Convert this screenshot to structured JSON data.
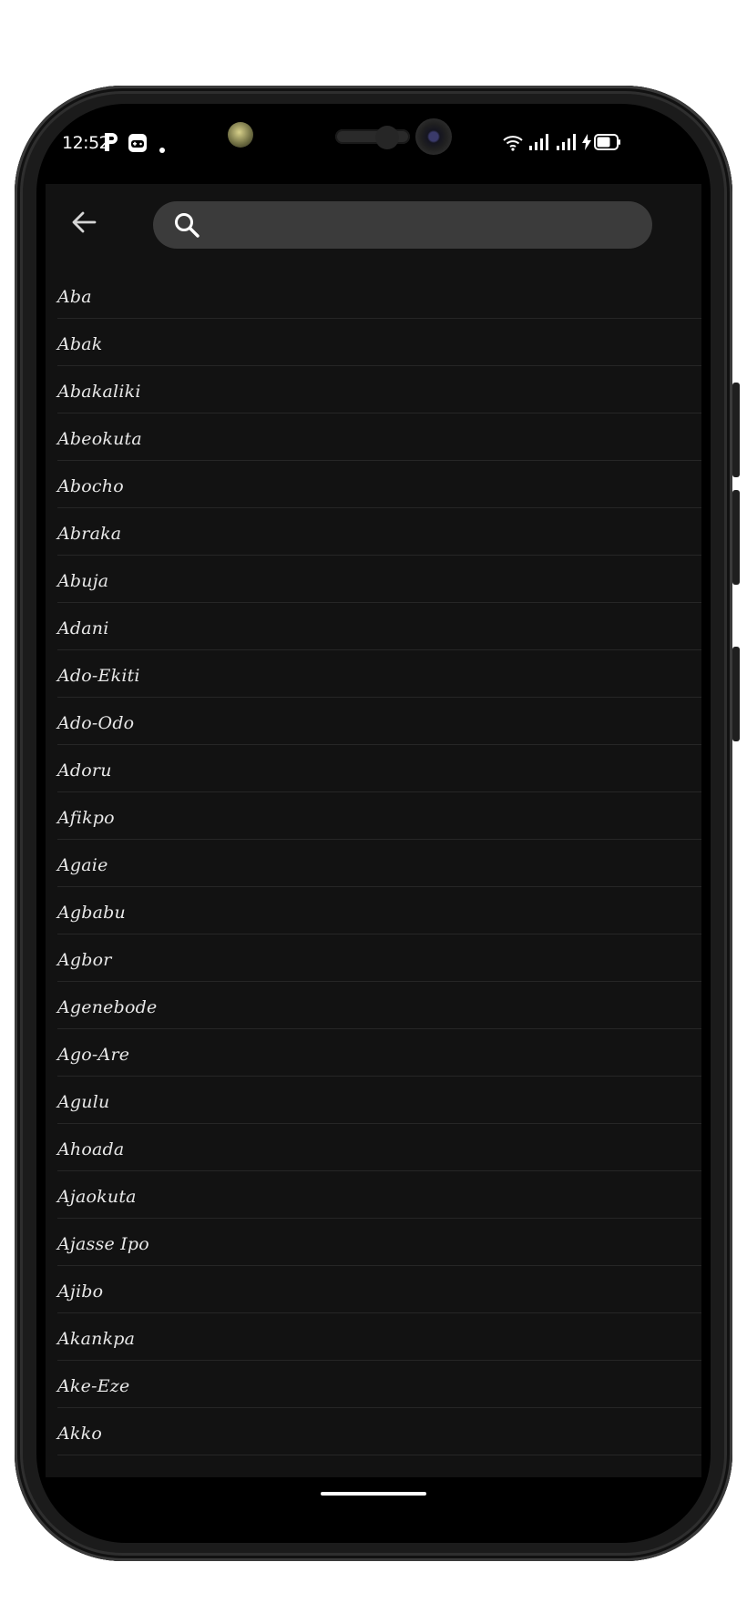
{
  "status_bar": {
    "time": "12:52",
    "battery": "66",
    "notification_icons": [
      "parking-p-icon",
      "gamepad-icon",
      "dot-icon"
    ],
    "system_icons": [
      "wifi-icon",
      "signal-icon",
      "signal-icon",
      "charging-icon",
      "battery-icon"
    ]
  },
  "header": {
    "back_icon": "arrow-left-icon",
    "search_icon": "search-icon",
    "search_value": "",
    "search_placeholder": ""
  },
  "colors": {
    "app_background": "#121212",
    "search_background": "#3b3b3b",
    "divider": "#262626",
    "text": "#e8e8e8"
  },
  "cities": [
    "Aba",
    "Abak",
    "Abakaliki",
    "Abeokuta",
    "Abocho",
    "Abraka",
    "Abuja",
    "Adani",
    "Ado-Ekiti",
    "Ado-Odo",
    "Adoru",
    "Afikpo",
    "Agaie",
    "Agbabu",
    "Agbor",
    "Agenebode",
    "Ago-Are",
    "Agulu",
    "Ahoada",
    "Ajaokuta",
    "Ajasse Ipo",
    "Ajibo",
    "Akankpa",
    "Ake-Eze",
    "Akko"
  ]
}
